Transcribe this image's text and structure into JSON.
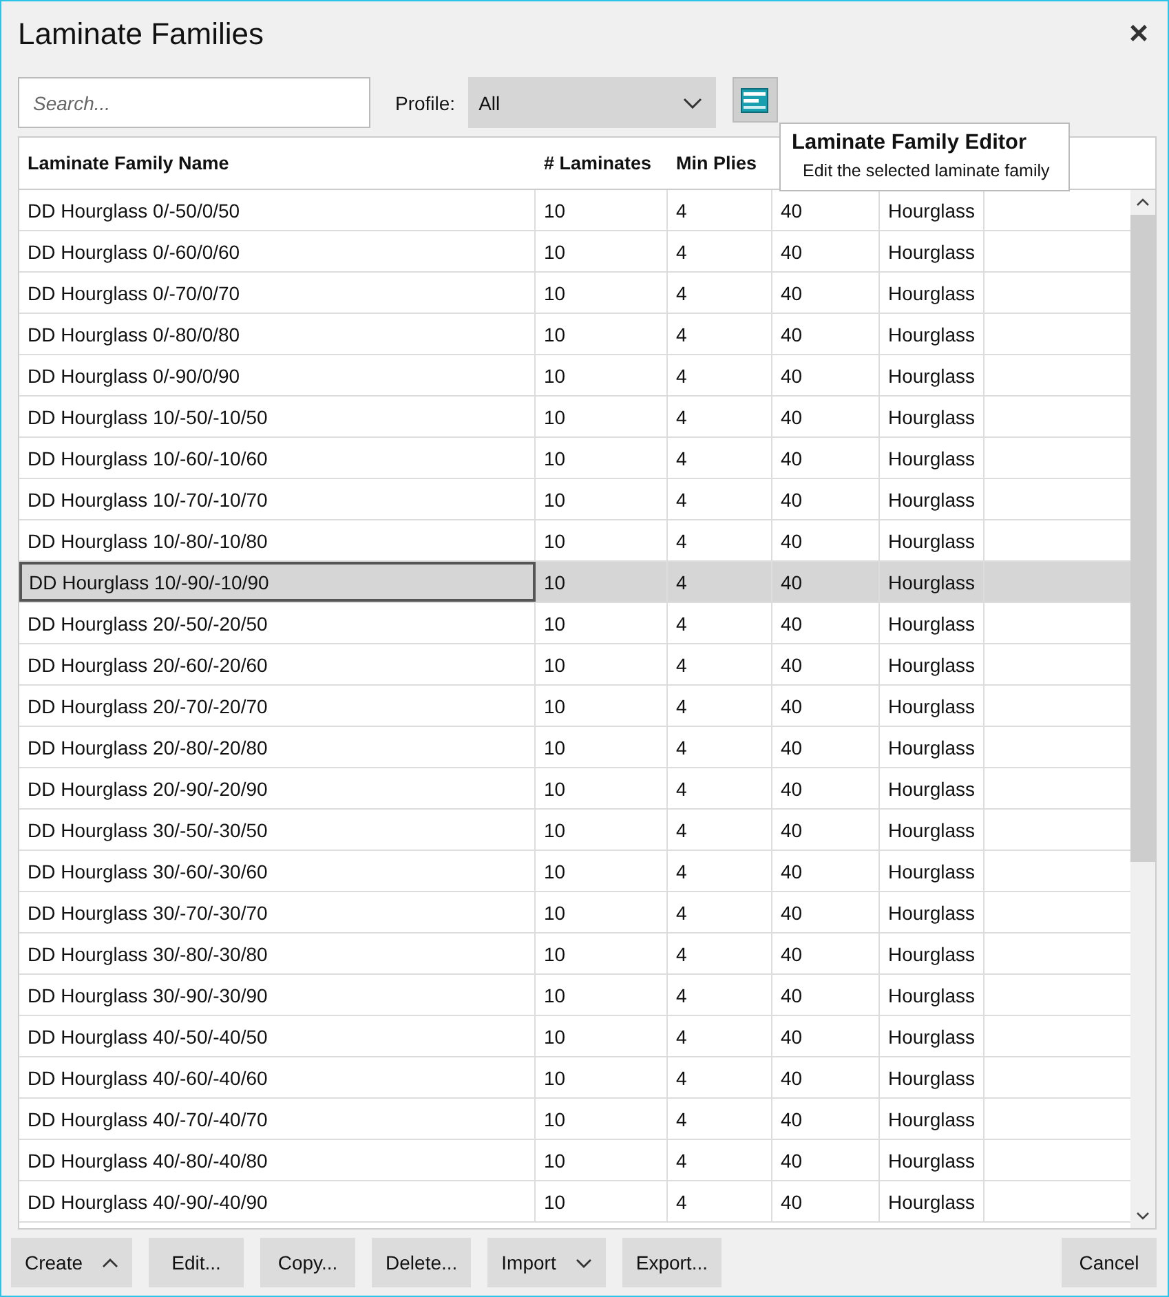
{
  "window": {
    "title": "Laminate Families",
    "close": "×"
  },
  "search": {
    "placeholder": "Search..."
  },
  "profile": {
    "label": "Profile:",
    "value": "All"
  },
  "tooltip": {
    "title": "Laminate Family Editor",
    "text": "Edit the selected laminate family"
  },
  "table": {
    "columns": [
      "Laminate Family Name",
      "# Laminates",
      "Min Plies"
    ],
    "rows": [
      {
        "cells": [
          "DD Hourglass 0/-50/0/50",
          "10",
          "4",
          "40",
          "Hourglass"
        ],
        "selected": false
      },
      {
        "cells": [
          "DD Hourglass 0/-60/0/60",
          "10",
          "4",
          "40",
          "Hourglass"
        ],
        "selected": false
      },
      {
        "cells": [
          "DD Hourglass 0/-70/0/70",
          "10",
          "4",
          "40",
          "Hourglass"
        ],
        "selected": false
      },
      {
        "cells": [
          "DD Hourglass 0/-80/0/80",
          "10",
          "4",
          "40",
          "Hourglass"
        ],
        "selected": false
      },
      {
        "cells": [
          "DD Hourglass 0/-90/0/90",
          "10",
          "4",
          "40",
          "Hourglass"
        ],
        "selected": false
      },
      {
        "cells": [
          "DD Hourglass 10/-50/-10/50",
          "10",
          "4",
          "40",
          "Hourglass"
        ],
        "selected": false
      },
      {
        "cells": [
          "DD Hourglass 10/-60/-10/60",
          "10",
          "4",
          "40",
          "Hourglass"
        ],
        "selected": false
      },
      {
        "cells": [
          "DD Hourglass 10/-70/-10/70",
          "10",
          "4",
          "40",
          "Hourglass"
        ],
        "selected": false
      },
      {
        "cells": [
          "DD Hourglass 10/-80/-10/80",
          "10",
          "4",
          "40",
          "Hourglass"
        ],
        "selected": false
      },
      {
        "cells": [
          "DD Hourglass 10/-90/-10/90",
          "10",
          "4",
          "40",
          "Hourglass"
        ],
        "selected": true
      },
      {
        "cells": [
          "DD Hourglass 20/-50/-20/50",
          "10",
          "4",
          "40",
          "Hourglass"
        ],
        "selected": false
      },
      {
        "cells": [
          "DD Hourglass 20/-60/-20/60",
          "10",
          "4",
          "40",
          "Hourglass"
        ],
        "selected": false
      },
      {
        "cells": [
          "DD Hourglass 20/-70/-20/70",
          "10",
          "4",
          "40",
          "Hourglass"
        ],
        "selected": false
      },
      {
        "cells": [
          "DD Hourglass 20/-80/-20/80",
          "10",
          "4",
          "40",
          "Hourglass"
        ],
        "selected": false
      },
      {
        "cells": [
          "DD Hourglass 20/-90/-20/90",
          "10",
          "4",
          "40",
          "Hourglass"
        ],
        "selected": false
      },
      {
        "cells": [
          "DD Hourglass 30/-50/-30/50",
          "10",
          "4",
          "40",
          "Hourglass"
        ],
        "selected": false
      },
      {
        "cells": [
          "DD Hourglass 30/-60/-30/60",
          "10",
          "4",
          "40",
          "Hourglass"
        ],
        "selected": false
      },
      {
        "cells": [
          "DD Hourglass 30/-70/-30/70",
          "10",
          "4",
          "40",
          "Hourglass"
        ],
        "selected": false
      },
      {
        "cells": [
          "DD Hourglass 30/-80/-30/80",
          "10",
          "4",
          "40",
          "Hourglass"
        ],
        "selected": false
      },
      {
        "cells": [
          "DD Hourglass 30/-90/-30/90",
          "10",
          "4",
          "40",
          "Hourglass"
        ],
        "selected": false
      },
      {
        "cells": [
          "DD Hourglass 40/-50/-40/50",
          "10",
          "4",
          "40",
          "Hourglass"
        ],
        "selected": false
      },
      {
        "cells": [
          "DD Hourglass 40/-60/-40/60",
          "10",
          "4",
          "40",
          "Hourglass"
        ],
        "selected": false
      },
      {
        "cells": [
          "DD Hourglass 40/-70/-40/70",
          "10",
          "4",
          "40",
          "Hourglass"
        ],
        "selected": false
      },
      {
        "cells": [
          "DD Hourglass 40/-80/-40/80",
          "10",
          "4",
          "40",
          "Hourglass"
        ],
        "selected": false
      },
      {
        "cells": [
          "DD Hourglass 40/-90/-40/90",
          "10",
          "4",
          "40",
          "Hourglass"
        ],
        "selected": false
      }
    ]
  },
  "buttons": [
    {
      "label": "Create",
      "kind": "menu-up"
    },
    {
      "label": "Edit...",
      "kind": "plain"
    },
    {
      "label": "Copy...",
      "kind": "plain"
    },
    {
      "label": "Delete...",
      "kind": "plain"
    },
    {
      "label": "Import",
      "kind": "menu-down"
    },
    {
      "label": "Export...",
      "kind": "plain"
    },
    {
      "label": "Cancel",
      "kind": "end"
    }
  ]
}
